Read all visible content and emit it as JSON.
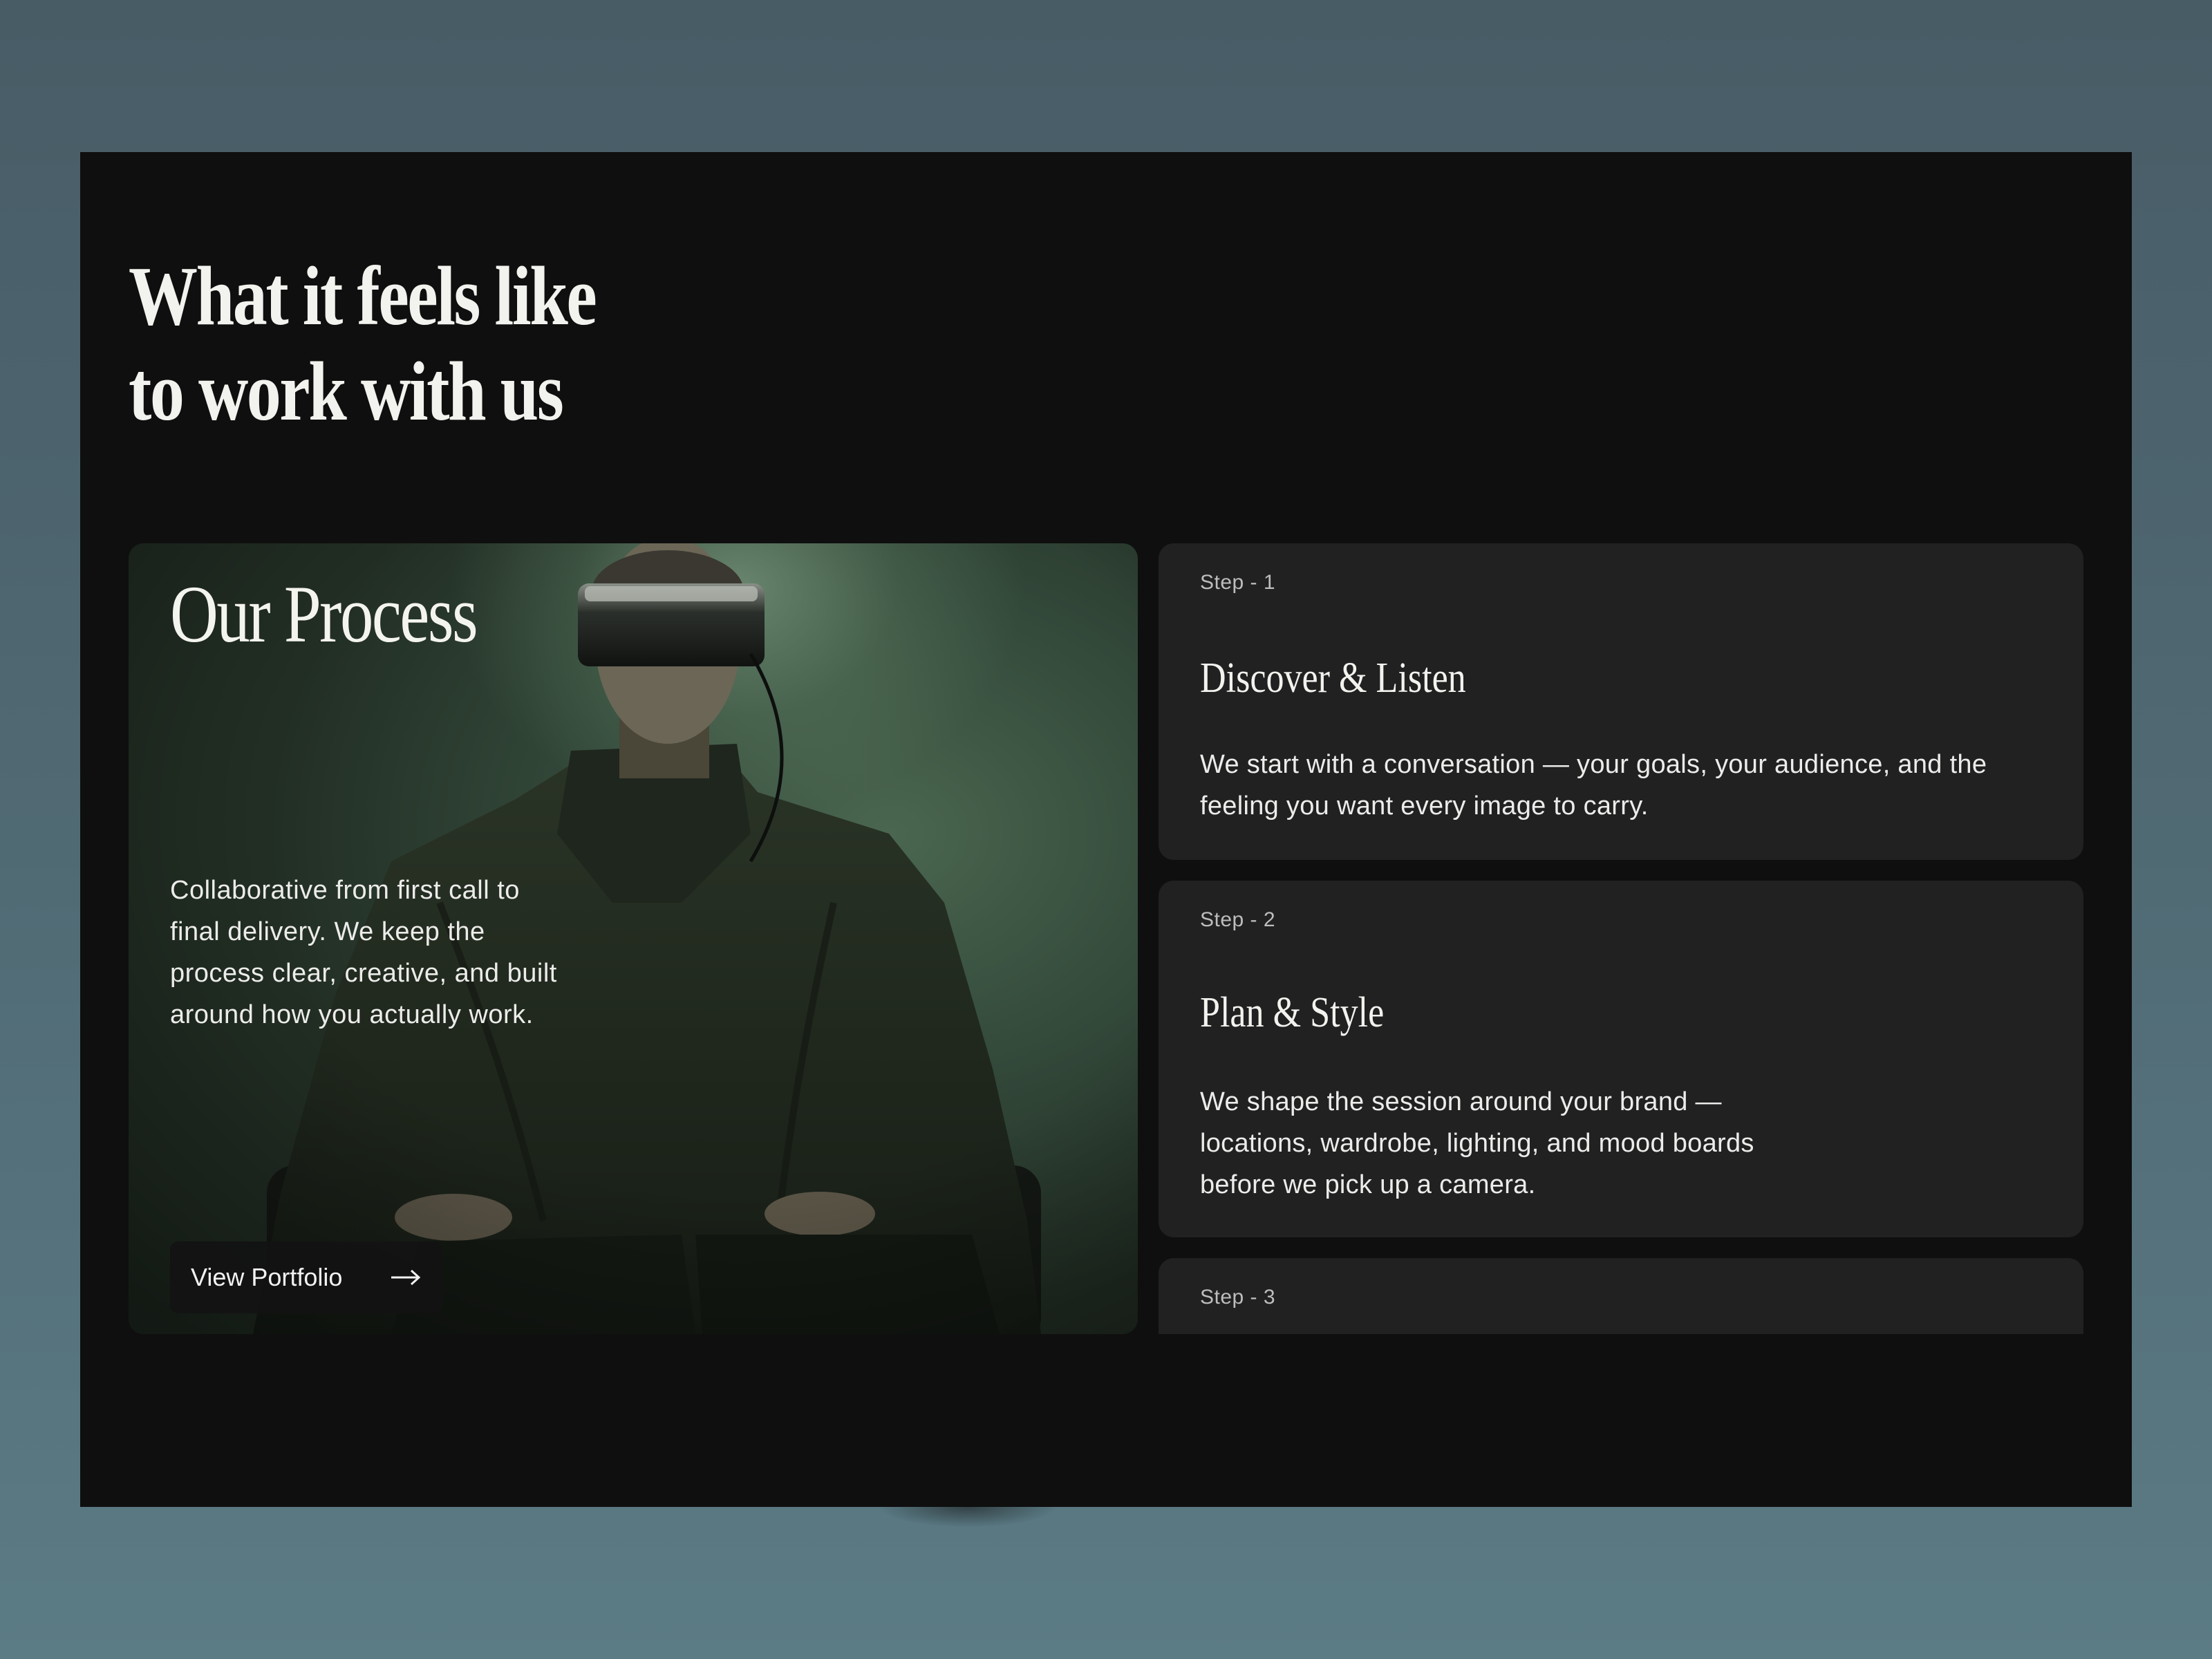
{
  "section": {
    "headline_line1": "What it feels like",
    "headline_line2": "to work with us"
  },
  "process": {
    "title": "Our Process",
    "description": "Collaborative from first call to final delivery. We keep the process clear, creative, and built around how you actually work.",
    "button_label": "View Portfolio",
    "button_icon": "arrow-right-icon"
  },
  "steps": [
    {
      "label": "Step - 1",
      "title": "Discover & Listen",
      "description": "We start with a conversation — your goals, your audience, and the feeling you want every image to carry."
    },
    {
      "label": "Step - 2",
      "title": "Plan & Style",
      "description": "We shape the session around your brand — locations, wardrobe, lighting, and mood boards before we pick up a camera."
    },
    {
      "label": "Step - 3",
      "title": "",
      "description": ""
    }
  ],
  "colors": {
    "page_background": "#4f6872",
    "frame_background": "#0f0f0f",
    "card_background": "#212121",
    "text_primary": "#f2f2ee",
    "text_muted": "#bdbdbd"
  }
}
